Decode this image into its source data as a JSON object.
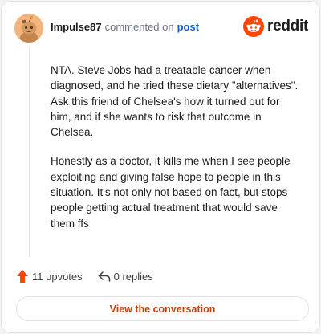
{
  "header": {
    "username": "Impulse87",
    "action_text": "commented on",
    "target_link": "post",
    "brand": "reddit"
  },
  "comment": {
    "paragraphs": [
      "NTA. Steve Jobs had a treatable cancer when diagnosed, and he tried these dietary \"alternatives\". Ask this friend of Chelsea's how it turned out for him, and if she wants to risk that outcome in Chelsea.",
      "Honestly as a doctor, it kills me when I see people exploiting and giving false hope to people in this situation. It's not only not based on fact, but stops people getting actual treatment that would save them ffs"
    ]
  },
  "actions": {
    "upvotes_label": "11 upvotes",
    "replies_label": "0 replies"
  },
  "footer": {
    "view_button_label": "View the conversation"
  },
  "colors": {
    "accent": "#ff4500",
    "link": "#0f5fd1",
    "button_text": "#c2410c"
  }
}
